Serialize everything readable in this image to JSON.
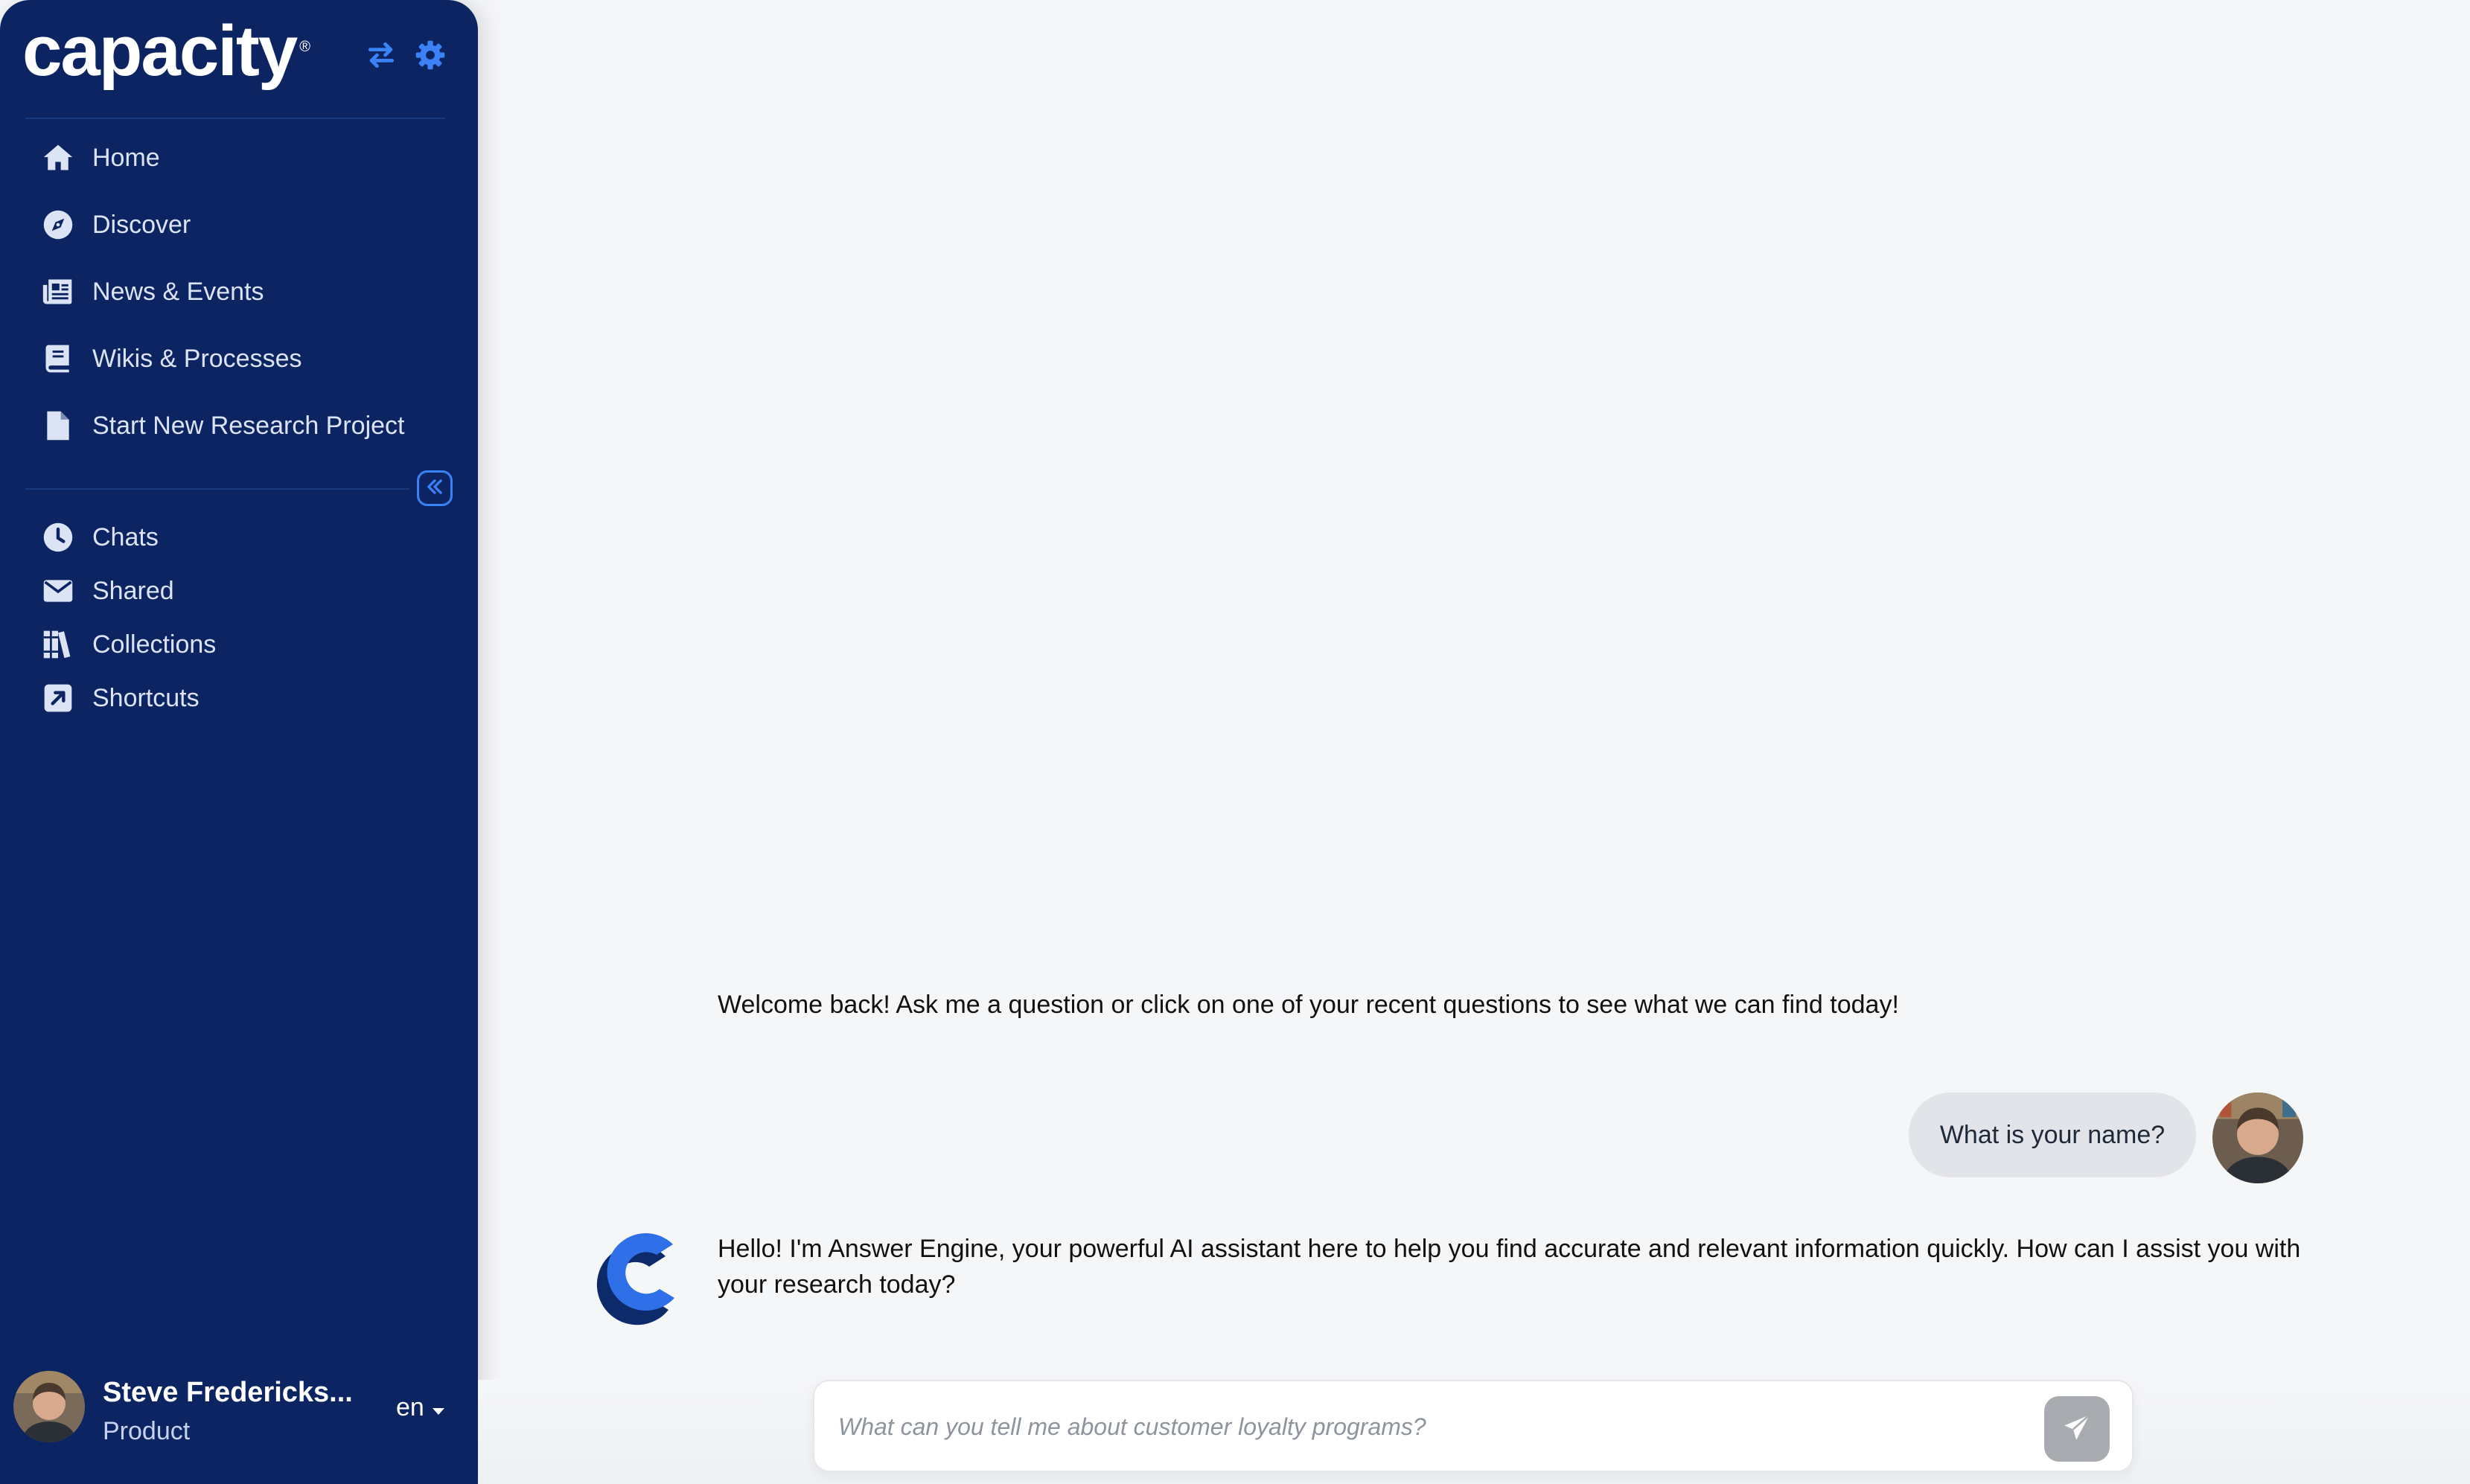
{
  "app": {
    "logo_text": "capacity",
    "logo_mark": "®"
  },
  "sidebar": {
    "top_icons": [
      "swap-arrows-icon",
      "gear-icon"
    ],
    "primary_items": [
      {
        "label": "Home",
        "icon": "home-icon"
      },
      {
        "label": "Discover",
        "icon": "compass-icon"
      },
      {
        "label": "News & Events",
        "icon": "newspaper-icon"
      },
      {
        "label": "Wikis & Processes",
        "icon": "book-icon"
      },
      {
        "label": "Start New Research Project",
        "icon": "file-icon"
      }
    ],
    "secondary_items": [
      {
        "label": "Chats",
        "icon": "clock-icon"
      },
      {
        "label": "Shared",
        "icon": "envelope-icon"
      },
      {
        "label": "Collections",
        "icon": "library-icon"
      },
      {
        "label": "Shortcuts",
        "icon": "external-link-square-icon"
      }
    ],
    "collapse_icon": "double-chevron-left-icon",
    "profile": {
      "name": "Steve Fredericks...",
      "role": "Product",
      "language": "en"
    }
  },
  "chat": {
    "welcome": "Welcome back! Ask me a question or click on one of your recent questions to see what we can find today!",
    "user_message": "What is your name?",
    "bot_message": "Hello! I'm Answer Engine, your powerful AI assistant here to help you find accurate and relevant information quickly. How can I assist you with your research today?",
    "input_placeholder": "What can you tell me about customer loyalty programs?"
  },
  "colors": {
    "sidebar_bg": "#0c2461",
    "accent": "#3b82f6",
    "page_bg": "#f5f6f8",
    "bubble_bg": "#e2e4ea",
    "send_disabled": "#a8abb0"
  }
}
